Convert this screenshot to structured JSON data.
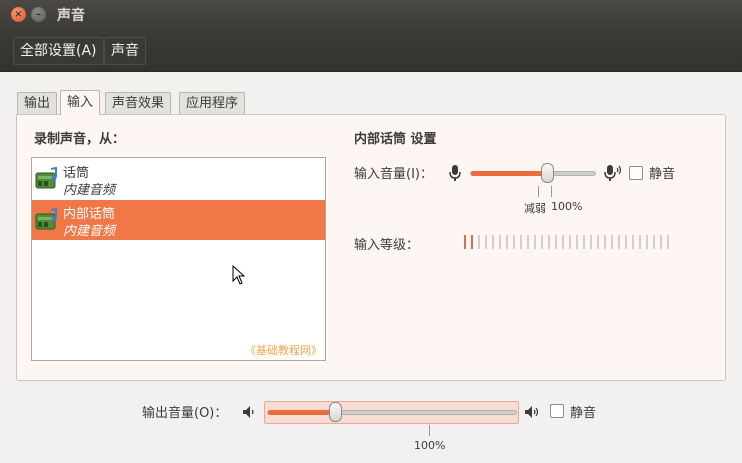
{
  "window": {
    "title": "声音"
  },
  "toolbar": {
    "all_settings": "全部设置(A)",
    "crumb": "声音"
  },
  "tabs": [
    {
      "label": "输出",
      "active": false
    },
    {
      "label": "输入",
      "active": true
    },
    {
      "label": "声音效果",
      "active": false
    },
    {
      "label": "应用程序",
      "active": false
    }
  ],
  "record": {
    "label": "录制声音，从：",
    "devices": [
      {
        "name": "话筒",
        "sub": "内建音频",
        "selected": false
      },
      {
        "name": "内部话筒",
        "sub": "内建音频",
        "selected": true
      }
    ],
    "watermark": "《基础教程网》"
  },
  "input_settings": {
    "title": "内部话筒 设置",
    "volume_label": "输入音量(I)：",
    "volume_fraction": 0.6,
    "weak_label": "减弱",
    "hundred_label": "100%",
    "mute_label": "静音",
    "mute_checked": false,
    "level_label": "输入等级：",
    "level_bars_total": 30,
    "level_bars_on": 2
  },
  "output": {
    "volume_label": "输出音量(O)：",
    "volume_fraction": 0.29,
    "hundred_label": "100%",
    "mute_label": "静音",
    "mute_checked": false
  },
  "colors": {
    "accent": "#f07746",
    "titlebar": "#3c3b37",
    "panel": "#fdf6f3"
  },
  "icons": [
    "close-icon",
    "minimize-icon",
    "microphone-icon",
    "speaker-icon",
    "audio-device-icon",
    "mouse-pointer-icon"
  ]
}
